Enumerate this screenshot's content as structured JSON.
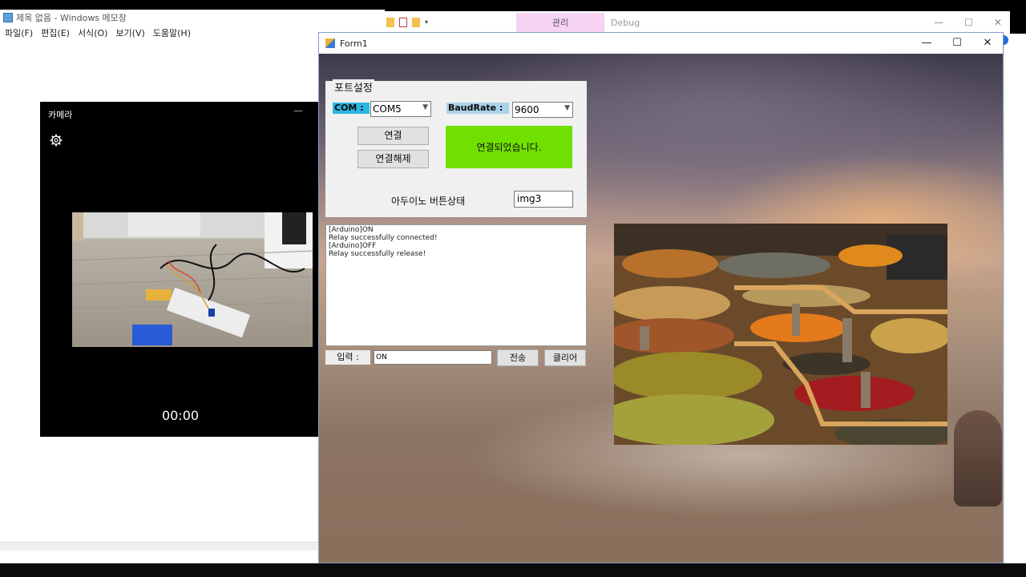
{
  "notepad": {
    "title": "제목 없음 - Windows 메모장",
    "menu": [
      "파일(F)",
      "편집(E)",
      "서식(O)",
      "보기(V)",
      "도움말(H)"
    ]
  },
  "explorer": {
    "manage_tab": "관리",
    "debug_label": "Debug",
    "controls": [
      "—",
      "☐",
      "✕"
    ]
  },
  "camera": {
    "title": "카메라",
    "minimize": "—",
    "timer": "00:00"
  },
  "form1": {
    "title": "Form1",
    "controls": [
      "—",
      "☐",
      "✕"
    ],
    "port_group_title": "포트설정",
    "com_label": "COM :",
    "com_value": "COM5",
    "baud_label": "BaudRate :",
    "baud_value": "9600",
    "connect_button": "연결",
    "disconnect_button": "연결해제",
    "status_text": "연결되었습니다.",
    "arduino_label": "아두이노 버튼상태",
    "arduino_value": "img3",
    "log_lines": [
      "[Arduino]ON",
      "Relay successfully connected!",
      "[Arduino]OFF",
      "Relay successfully release!"
    ],
    "input_label": "입력 :",
    "input_value": "ON",
    "send_button": "전송",
    "clear_button": "클리어"
  },
  "colors": {
    "status_green": "#70e000",
    "com_label_bg": "#2bb7df",
    "baud_label_bg": "#aad3ea",
    "manage_tab_bg": "#f6d2f3"
  }
}
